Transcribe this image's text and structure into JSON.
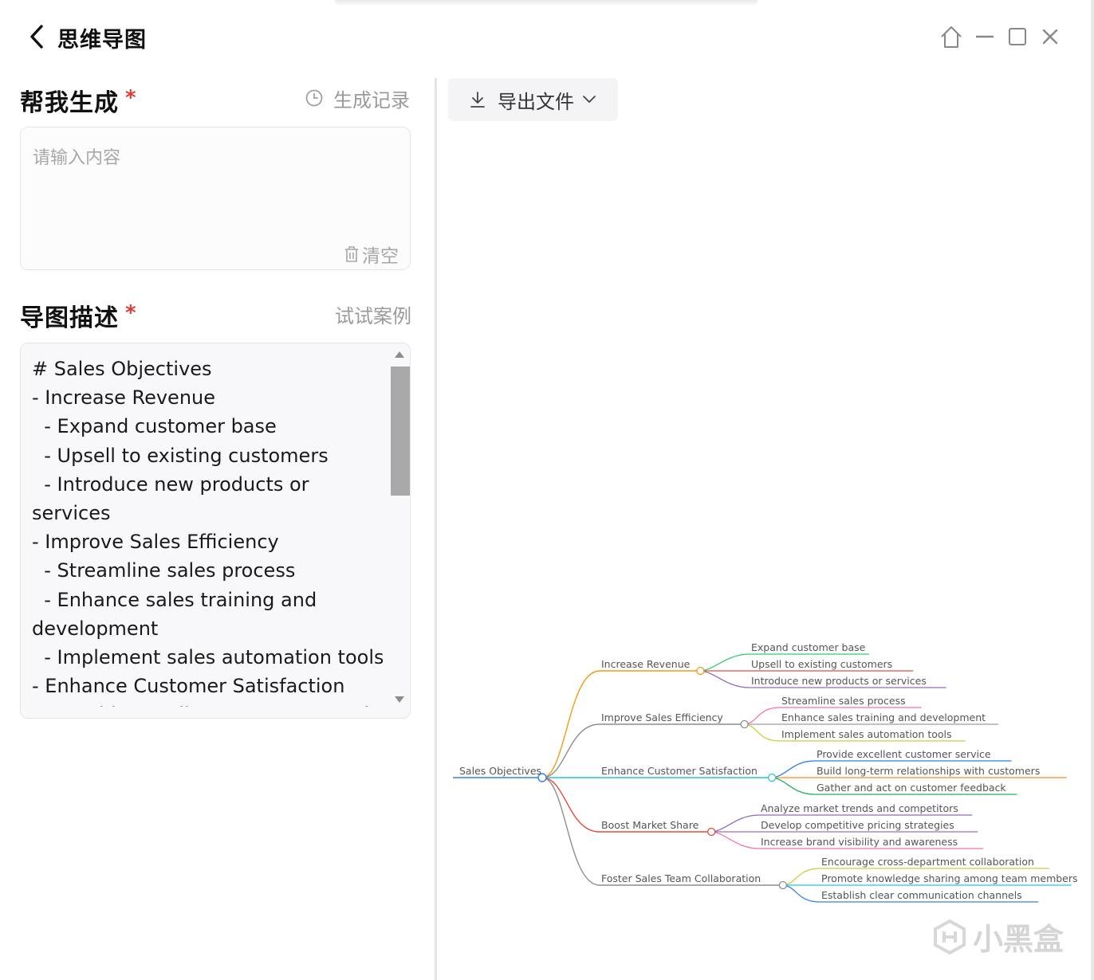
{
  "titlebar": {
    "title": "思维导图",
    "icons": [
      "back-chevron-icon",
      "home-icon",
      "minimize-icon",
      "maximize-icon",
      "close-icon"
    ]
  },
  "generate": {
    "title": "帮我生成",
    "required_mark": "*",
    "history_label": "生成记录",
    "input_placeholder": "请输入内容",
    "input_value": "",
    "clear_label": "清空"
  },
  "description": {
    "title": "导图描述",
    "required_mark": "*",
    "try_example_label": "试试案例",
    "lines": [
      "# Sales Objectives",
      "- Increase Revenue",
      "  - Expand customer base",
      "  - Upsell to existing customers",
      "  - Introduce new products or",
      "services",
      "- Improve Sales Efficiency",
      "  - Streamline sales process",
      "  - Enhance sales training and",
      "development",
      "  - Implement sales automation tools",
      "- Enhance Customer Satisfaction",
      "  - Provide excellent customer service"
    ]
  },
  "export": {
    "label": "导出文件"
  },
  "mindmap": {
    "root": "Sales Objectives",
    "branches": [
      {
        "label": "Increase Revenue",
        "color": "#f39c12",
        "children": [
          {
            "label": "Expand customer base",
            "color": "#2ecc71"
          },
          {
            "label": "Upsell to existing customers",
            "color": "#e74c3c"
          },
          {
            "label": "Introduce new products or services",
            "color": "#8e6bbf"
          }
        ]
      },
      {
        "label": "Improve Sales Efficiency",
        "color": "#8e8e8e",
        "children": [
          {
            "label": "Streamline sales process",
            "color": "#ff6fae"
          },
          {
            "label": "Enhance sales training and development",
            "color": "#9e9e9e"
          },
          {
            "label": "Implement sales automation tools",
            "color": "#c7d13a"
          }
        ]
      },
      {
        "label": "Enhance Customer Satisfaction",
        "color": "#26c6da",
        "children": [
          {
            "label": "Provide excellent customer service",
            "color": "#2f80ed"
          },
          {
            "label": "Build long-term relationships with customers",
            "color": "#ff8c1a"
          },
          {
            "label": "Gather and act on customer feedback",
            "color": "#27ae60"
          }
        ]
      },
      {
        "label": "Boost Market Share",
        "color": "#e74c3c",
        "children": [
          {
            "label": "Analyze market trends and competitors",
            "color": "#8e6bbf"
          },
          {
            "label": "Develop competitive pricing strategies",
            "color": "#a569bd"
          },
          {
            "label": "Increase brand visibility and awareness",
            "color": "#ff6fae"
          }
        ]
      },
      {
        "label": "Foster Sales Team Collaboration",
        "color": "#8e8e8e",
        "children": [
          {
            "label": "Encourage cross-department collaboration",
            "color": "#c7d13a"
          },
          {
            "label": "Promote knowledge sharing among team members",
            "color": "#26c6da"
          },
          {
            "label": "Establish clear communication channels",
            "color": "#2f80ed"
          }
        ]
      }
    ],
    "root_color": "#2f80ed"
  },
  "watermark": {
    "text": "小黑盒"
  }
}
